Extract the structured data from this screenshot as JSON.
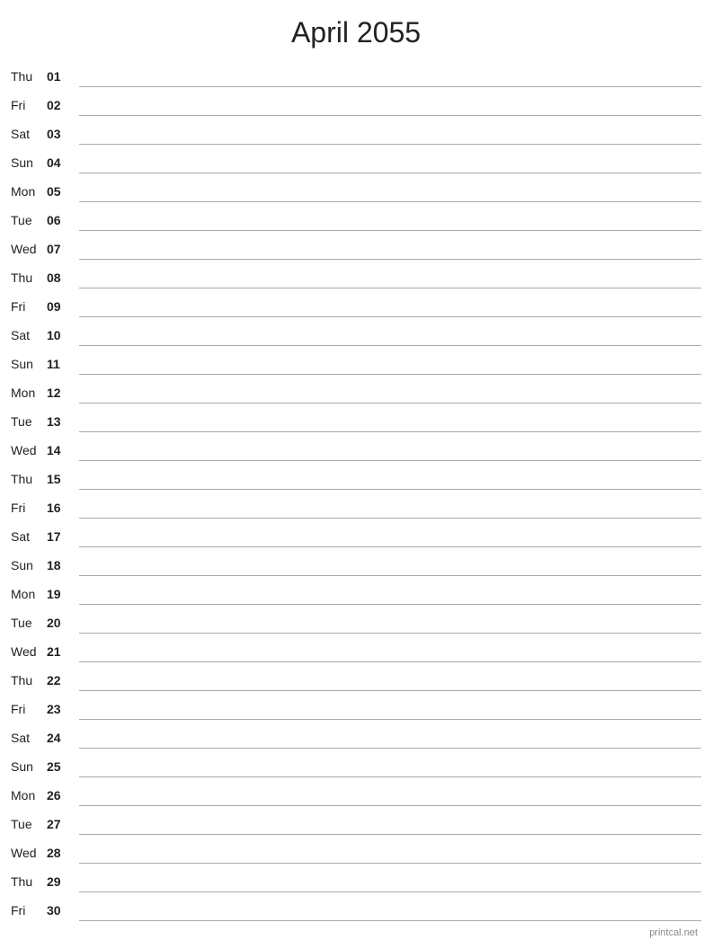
{
  "title": "April 2055",
  "footer": "printcal.net",
  "days": [
    {
      "name": "Thu",
      "num": "01"
    },
    {
      "name": "Fri",
      "num": "02"
    },
    {
      "name": "Sat",
      "num": "03"
    },
    {
      "name": "Sun",
      "num": "04"
    },
    {
      "name": "Mon",
      "num": "05"
    },
    {
      "name": "Tue",
      "num": "06"
    },
    {
      "name": "Wed",
      "num": "07"
    },
    {
      "name": "Thu",
      "num": "08"
    },
    {
      "name": "Fri",
      "num": "09"
    },
    {
      "name": "Sat",
      "num": "10"
    },
    {
      "name": "Sun",
      "num": "11"
    },
    {
      "name": "Mon",
      "num": "12"
    },
    {
      "name": "Tue",
      "num": "13"
    },
    {
      "name": "Wed",
      "num": "14"
    },
    {
      "name": "Thu",
      "num": "15"
    },
    {
      "name": "Fri",
      "num": "16"
    },
    {
      "name": "Sat",
      "num": "17"
    },
    {
      "name": "Sun",
      "num": "18"
    },
    {
      "name": "Mon",
      "num": "19"
    },
    {
      "name": "Tue",
      "num": "20"
    },
    {
      "name": "Wed",
      "num": "21"
    },
    {
      "name": "Thu",
      "num": "22"
    },
    {
      "name": "Fri",
      "num": "23"
    },
    {
      "name": "Sat",
      "num": "24"
    },
    {
      "name": "Sun",
      "num": "25"
    },
    {
      "name": "Mon",
      "num": "26"
    },
    {
      "name": "Tue",
      "num": "27"
    },
    {
      "name": "Wed",
      "num": "28"
    },
    {
      "name": "Thu",
      "num": "29"
    },
    {
      "name": "Fri",
      "num": "30"
    }
  ]
}
